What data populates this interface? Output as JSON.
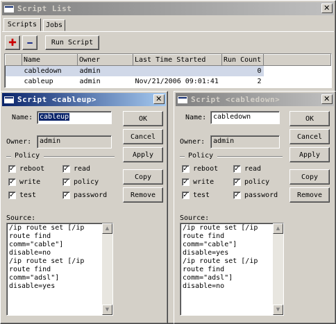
{
  "script_list": {
    "title": "Script List",
    "close_glyph": "✕",
    "tabs": [
      "Scripts",
      "Jobs"
    ],
    "add_glyph": "✚",
    "remove_glyph": "━",
    "run_button": "Run Script",
    "columns": [
      "Name",
      "Owner",
      "Last Time Started",
      "Run Count"
    ],
    "rows": [
      {
        "name": "cabledown",
        "owner": "admin",
        "last": "",
        "count": "0"
      },
      {
        "name": "cableup",
        "owner": "admin",
        "last": "Nov/21/2006 09:01:41",
        "count": "2"
      }
    ]
  },
  "dialog_left": {
    "title": "Script <cableup>",
    "name_label": "Name:",
    "name_value": "cableup",
    "owner_label": "Owner:",
    "owner_value": "admin",
    "policy_label": "Policy",
    "policies": [
      "reboot",
      "read",
      "write",
      "policy",
      "test",
      "password"
    ],
    "check_glyph": "✓",
    "source_label": "Source:",
    "source": "/ip route set [/ip\nroute find\ncomm=\"cable\"]\ndisable=no\n/ip route set [/ip\nroute find\ncomm=\"adsl\"]\ndisable=yes",
    "buttons": {
      "ok": "OK",
      "cancel": "Cancel",
      "apply": "Apply",
      "copy": "Copy",
      "remove": "Remove"
    }
  },
  "dialog_right": {
    "title": "Script <cabledown>",
    "name_label": "Name:",
    "name_value": "cabledown",
    "owner_label": "Owner:",
    "owner_value": "admin",
    "policy_label": "Policy",
    "policies": [
      "reboot",
      "read",
      "write",
      "policy",
      "test",
      "password"
    ],
    "check_glyph": "✓",
    "source_label": "Source:",
    "source": "/ip route set [/ip\nroute find\ncomm=\"cable\"]\ndisable=yes\n/ip route set [/ip\nroute find\ncomm=\"adsl\"]\ndisable=no",
    "buttons": {
      "ok": "OK",
      "cancel": "Cancel",
      "apply": "Apply",
      "copy": "Copy",
      "remove": "Remove"
    }
  },
  "scroll_glyphs": {
    "up": "▲",
    "down": "▼"
  },
  "colors": {
    "active_title": "#0a246a",
    "selected_row": "#d0d8e8",
    "add_red": "#cc0000",
    "remove_blue": "#1c2f8a"
  }
}
